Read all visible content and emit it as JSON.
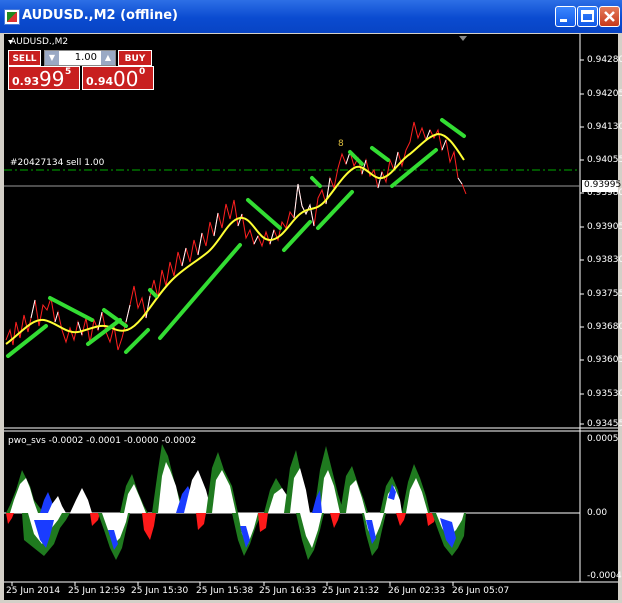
{
  "window": {
    "title": "AUDUSD.,M2 (offline)"
  },
  "symbol_label": "AUDUSD.,M2",
  "trade_panel": {
    "sell_label": "SELL",
    "buy_label": "BUY",
    "lot_value": "1.00",
    "sell_price_prefix": "0.93",
    "sell_price_big": "99",
    "sell_price_sup": "5",
    "buy_price_prefix": "0.94",
    "buy_price_big": "00",
    "buy_price_sup": "0"
  },
  "order_label": "#20427134 sell 1.00",
  "marker_label": "8",
  "price_axis": {
    "ticks": [
      "0.94280",
      "0.94205",
      "0.94130",
      "0.94055",
      "0.93980",
      "0.93905",
      "0.93830",
      "0.93755",
      "0.93680",
      "0.93605",
      "0.93530",
      "0.93455"
    ],
    "current_price": "0.93995"
  },
  "indicator": {
    "label": "pwo_svs -0.0002 -0.0001 -0.0000 -0.0002",
    "ticks": [
      "0.0005",
      "0.00",
      "-0.0004"
    ]
  },
  "time_axis": {
    "ticks": [
      "25 Jun 2014",
      "25 Jun 12:59",
      "25 Jun 15:30",
      "25 Jun 15:38",
      "25 Jun 16:33",
      "25 Jun 21:32",
      "26 Jun 02:33",
      "26 Jun 05:07"
    ]
  },
  "colors": {
    "up_line": "#ff2020",
    "down_line": "#ffffff",
    "moving_average": "#ffff33",
    "swing_segments": "#33dd33",
    "order_line": "#00aa00",
    "hist_white": "#ffffff",
    "hist_green": "#1f7a1f",
    "hist_blue": "#1a3cff",
    "hist_red": "#ff1a1a"
  }
}
